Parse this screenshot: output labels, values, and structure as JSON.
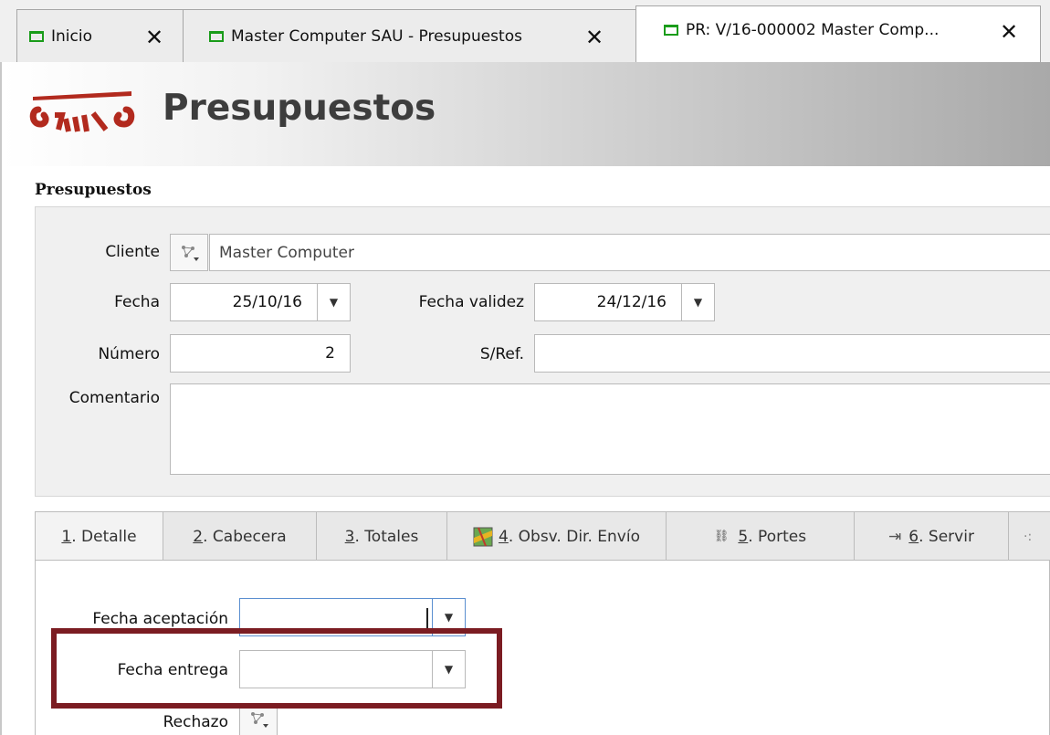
{
  "tabs": [
    {
      "label": "Inicio",
      "active": false
    },
    {
      "label": "Master Computer SAU - Presupuestos",
      "active": false
    },
    {
      "label": "PR: V/16-000002 Master Comp...",
      "active": true
    }
  ],
  "header": {
    "title": "Presupuestos"
  },
  "section": {
    "title": "Presupuestos"
  },
  "form": {
    "cliente_label": "Cliente",
    "cliente_value": "Master Computer",
    "fecha_label": "Fecha",
    "fecha_value": "25/10/16",
    "fecha_validez_label": "Fecha validez",
    "fecha_validez_value": "24/12/16",
    "numero_label": "Número",
    "numero_value": "2",
    "sref_label": "S/Ref.",
    "sref_value": "",
    "comentario_label": "Comentario",
    "comentario_value": ""
  },
  "subtabs": [
    {
      "num": "1",
      "rest": ". Detalle"
    },
    {
      "num": "2",
      "rest": ". Cabecera"
    },
    {
      "num": "3",
      "rest": ". Totales"
    },
    {
      "num": "4",
      "rest": ". Obsv. Dir. Envío"
    },
    {
      "num": "5",
      "rest": ". Portes"
    },
    {
      "num": "6",
      "rest": ". Servir"
    }
  ],
  "detail": {
    "fecha_aceptacion_label": "Fecha aceptación",
    "fecha_entrega_label": "Fecha entrega",
    "rechazo_label": "Rechazo"
  },
  "colors": {
    "tab_icon": "#1a9c1a",
    "highlight": "#7b1c22",
    "logo": "#b22a1e"
  }
}
